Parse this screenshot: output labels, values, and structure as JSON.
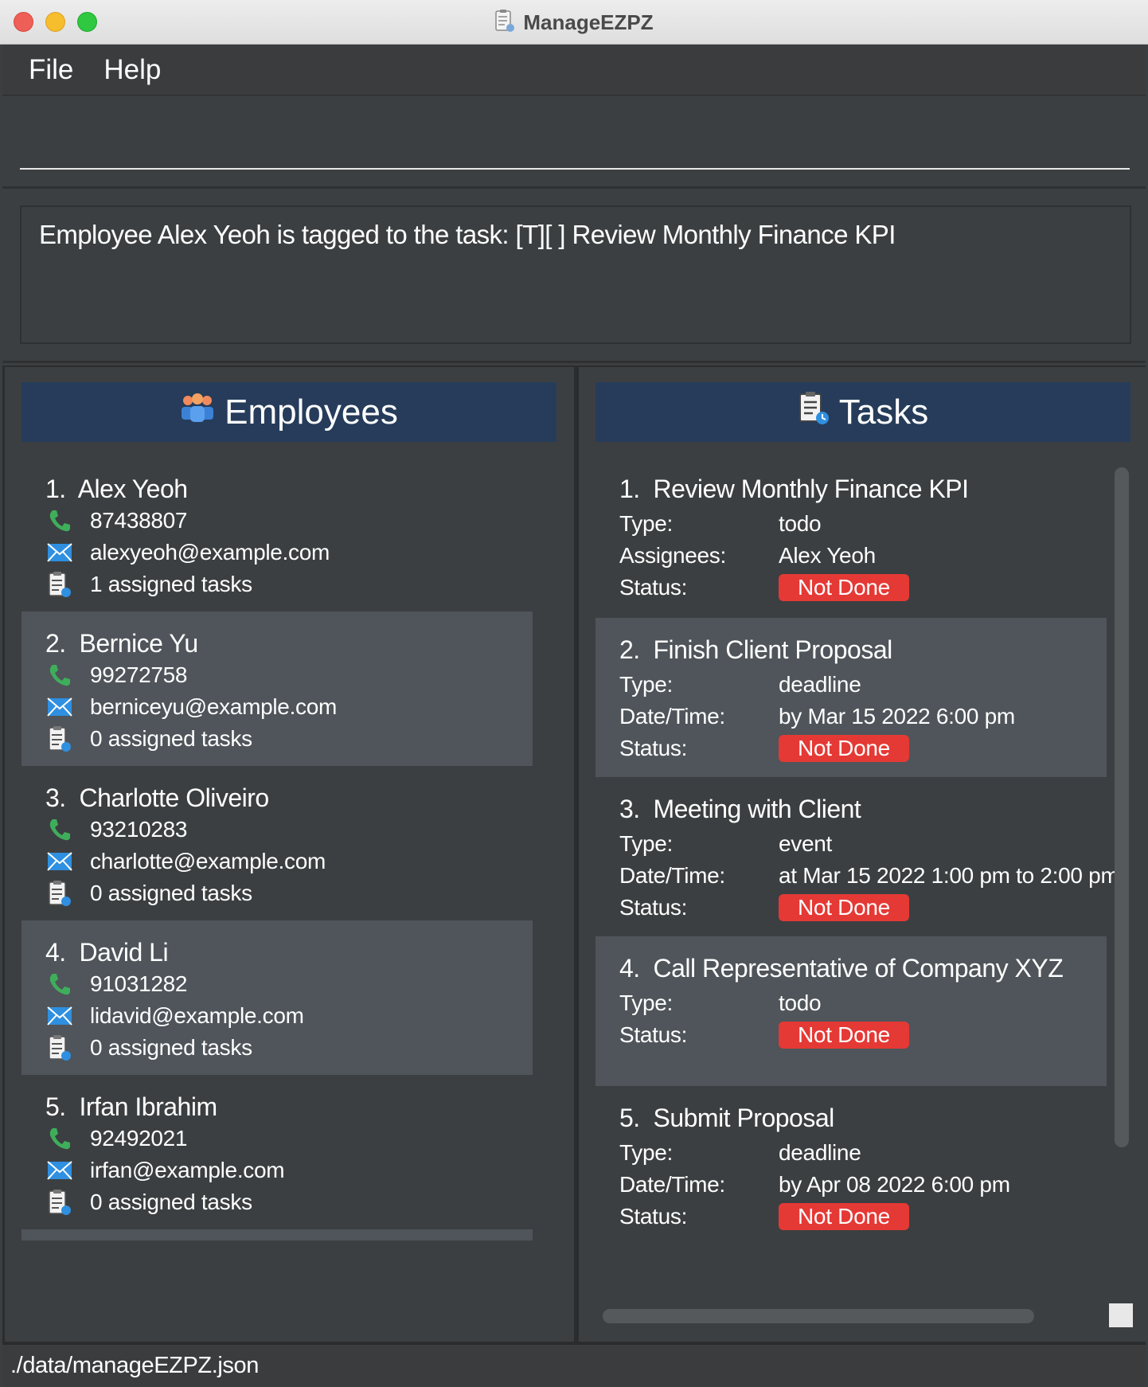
{
  "window": {
    "title": "ManageEZPZ"
  },
  "menu": {
    "file": "File",
    "help": "Help"
  },
  "command": {
    "value": ""
  },
  "result": {
    "text": "Employee Alex Yeoh is tagged to the task: [T][ ] Review Monthly Finance KPI"
  },
  "employees_panel": {
    "title": "Employees"
  },
  "tasks_panel": {
    "title": "Tasks"
  },
  "employees": [
    {
      "index": "1.",
      "name": "Alex Yeoh",
      "phone": "87438807",
      "email": "alexyeoh@example.com",
      "tasks": "1 assigned tasks"
    },
    {
      "index": "2.",
      "name": "Bernice Yu",
      "phone": "99272758",
      "email": "berniceyu@example.com",
      "tasks": "0 assigned tasks"
    },
    {
      "index": "3.",
      "name": "Charlotte Oliveiro",
      "phone": "93210283",
      "email": "charlotte@example.com",
      "tasks": "0 assigned tasks"
    },
    {
      "index": "4.",
      "name": "David Li",
      "phone": "91031282",
      "email": "lidavid@example.com",
      "tasks": "0 assigned tasks"
    },
    {
      "index": "5.",
      "name": "Irfan Ibrahim",
      "phone": "92492021",
      "email": "irfan@example.com",
      "tasks": "0 assigned tasks"
    }
  ],
  "tasks": [
    {
      "index": "1.",
      "name": "Review Monthly Finance KPI",
      "rows": [
        [
          "Type:",
          "todo"
        ],
        [
          "Assignees:",
          "Alex Yeoh"
        ]
      ],
      "status_label": "Status:",
      "status": "Not Done"
    },
    {
      "index": "2.",
      "name": "Finish Client Proposal",
      "rows": [
        [
          "Type:",
          "deadline"
        ],
        [
          "Date/Time:",
          "by Mar 15 2022 6:00 pm"
        ]
      ],
      "status_label": "Status:",
      "status": "Not Done"
    },
    {
      "index": "3.",
      "name": "Meeting with Client",
      "rows": [
        [
          "Type:",
          "event"
        ],
        [
          "Date/Time:",
          "at Mar 15 2022 1:00 pm to 2:00 pm"
        ]
      ],
      "status_label": "Status:",
      "status": "Not Done"
    },
    {
      "index": "4.",
      "name": "Call Representative of Company XYZ",
      "rows": [
        [
          "Type:",
          "todo"
        ]
      ],
      "status_label": "Status:",
      "status": "Not Done"
    },
    {
      "index": "5.",
      "name": "Submit Proposal",
      "rows": [
        [
          "Type:",
          "deadline"
        ],
        [
          "Date/Time:",
          "by Apr 08 2022 6:00 pm"
        ]
      ],
      "status_label": "Status:",
      "status": "Not Done"
    }
  ],
  "statusbar": {
    "path": "./data/manageEZPZ.json"
  },
  "icons": {
    "title": "task-list-icon",
    "employees": "people-icon",
    "tasks": "task-list-icon",
    "phone": "phone-icon",
    "email": "email-icon",
    "assigned": "task-list-icon"
  },
  "colors": {
    "background": "#3c3f41",
    "header": "#263c5a",
    "card_alt": "#4f555a",
    "status_not_done": "#e53935"
  }
}
